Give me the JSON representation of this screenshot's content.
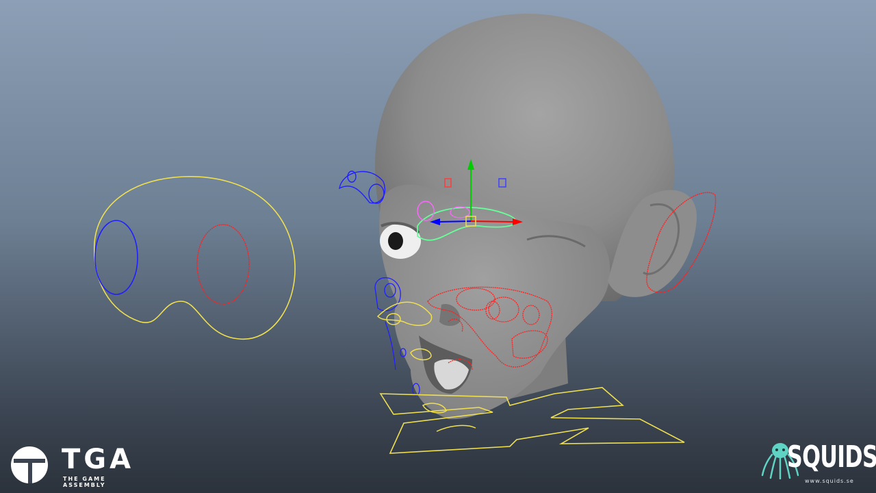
{
  "viewport": {
    "label": "3D viewport — facial rig",
    "colors": {
      "curve_left": "#2020ff",
      "curve_right": "#ff2020",
      "curve_center": "#f0e050",
      "curve_selected": "#66ff99",
      "curve_aux": "#ff66ff",
      "axis_x": "#ff0000",
      "axis_y": "#00cc00",
      "axis_z": "#0000ff",
      "mesh": "#8f8f8f"
    }
  },
  "branding": {
    "tga": {
      "title": "TGA",
      "subtitle": "THE GAME ASSEMBLY",
      "icon": "tga-logo-icon"
    },
    "squids": {
      "title": "SQUIDS",
      "url": "www.squids.se",
      "icon": "squid-logo-icon"
    }
  }
}
